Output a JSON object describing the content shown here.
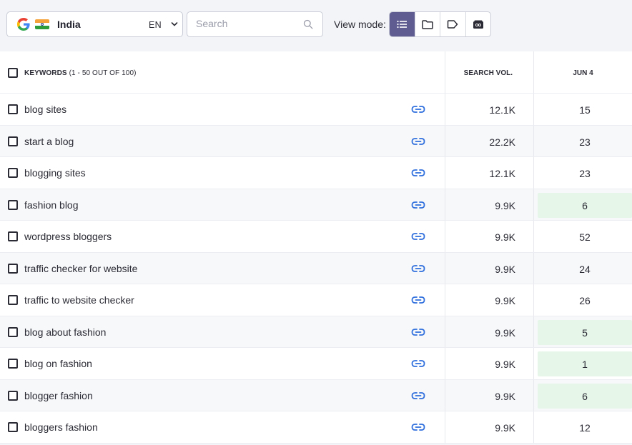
{
  "toolbar": {
    "location": {
      "search_engine_icon": "google-g-icon",
      "flag_icon": "india-flag-icon",
      "country": "India",
      "language": "EN"
    },
    "search": {
      "placeholder": "Search",
      "value": ""
    },
    "view_mode": {
      "label": "View mode:",
      "options": [
        {
          "icon": "list-icon",
          "active": true
        },
        {
          "icon": "folder-icon",
          "active": false
        },
        {
          "icon": "tag-icon",
          "active": false
        },
        {
          "icon": "gsc-icon",
          "active": false
        }
      ]
    }
  },
  "table": {
    "header": {
      "keywords": "KEYWORDS",
      "keywords_count": " (1 - 50 OUT OF 100)",
      "search_vol": "SEARCH VOL.",
      "date": "JUN 4"
    },
    "rows": [
      {
        "keyword": "blog sites",
        "volume": "12.1K",
        "position": "15",
        "highlight": false
      },
      {
        "keyword": "start a blog",
        "volume": "22.2K",
        "position": "23",
        "highlight": false
      },
      {
        "keyword": "blogging sites",
        "volume": "12.1K",
        "position": "23",
        "highlight": false
      },
      {
        "keyword": "fashion blog",
        "volume": "9.9K",
        "position": "6",
        "highlight": true
      },
      {
        "keyword": "wordpress bloggers",
        "volume": "9.9K",
        "position": "52",
        "highlight": false
      },
      {
        "keyword": "traffic checker for website",
        "volume": "9.9K",
        "position": "24",
        "highlight": false
      },
      {
        "keyword": "traffic to website checker",
        "volume": "9.9K",
        "position": "26",
        "highlight": false
      },
      {
        "keyword": "blog about fashion",
        "volume": "9.9K",
        "position": "5",
        "highlight": true
      },
      {
        "keyword": "blog on fashion",
        "volume": "9.9K",
        "position": "1",
        "highlight": true
      },
      {
        "keyword": "blogger fashion",
        "volume": "9.9K",
        "position": "6",
        "highlight": true
      },
      {
        "keyword": "bloggers fashion",
        "volume": "9.9K",
        "position": "12",
        "highlight": false
      }
    ]
  },
  "colors": {
    "accent": "#5f5c91",
    "link": "#2f6fdd",
    "highlight": "#e6f6e9"
  }
}
